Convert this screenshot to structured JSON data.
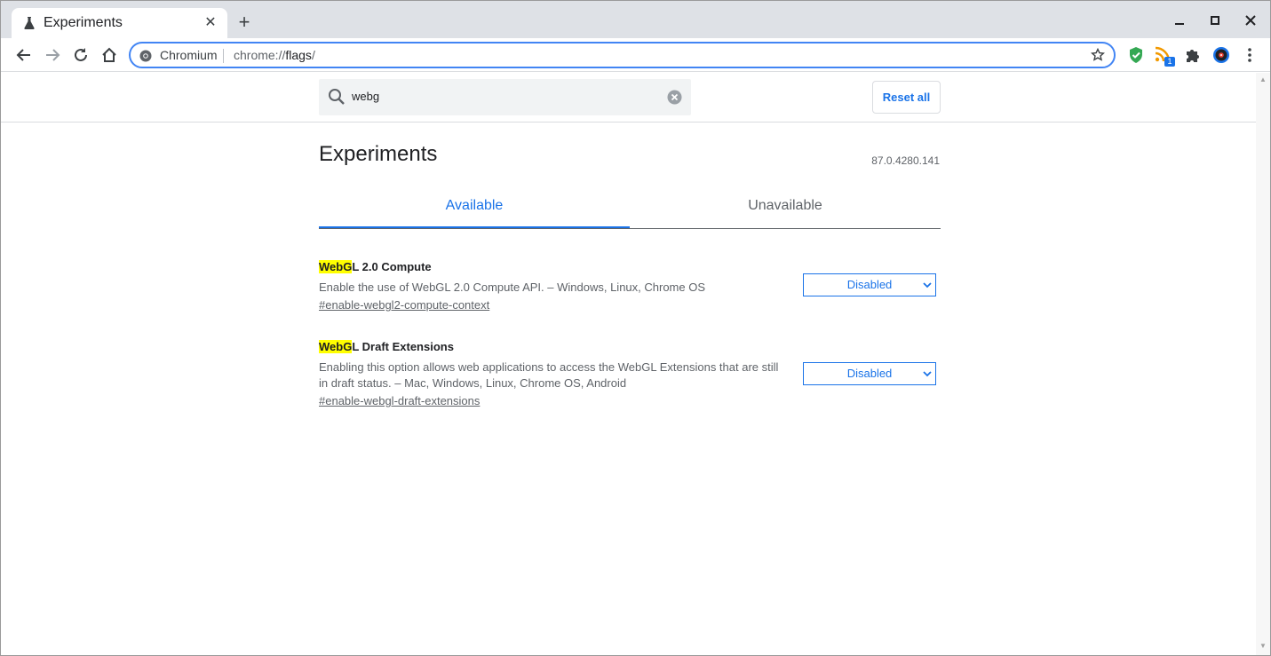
{
  "browser": {
    "tab_title": "Experiments",
    "new_tab_label": "+",
    "omnibox": {
      "site_label": "Chromium",
      "url_scheme": "chrome://",
      "url_host": "flags",
      "url_path": "/"
    },
    "extension_badge": "1"
  },
  "header": {
    "search_value": "webg",
    "reset_label": "Reset all"
  },
  "main": {
    "title": "Experiments",
    "version": "87.0.4280.141",
    "tabs": [
      {
        "label": "Available",
        "active": true
      },
      {
        "label": "Unavailable",
        "active": false
      }
    ],
    "experiments": [
      {
        "name_highlight": "WebG",
        "name_rest": "L 2.0 Compute",
        "description": "Enable the use of WebGL 2.0 Compute API. – Windows, Linux, Chrome OS",
        "link": "#enable-webgl2-compute-context",
        "selected": "Disabled"
      },
      {
        "name_highlight": "WebG",
        "name_rest": "L Draft Extensions",
        "description": "Enabling this option allows web applications to access the WebGL Extensions that are still in draft status. – Mac, Windows, Linux, Chrome OS, Android",
        "link": "#enable-webgl-draft-extensions",
        "selected": "Disabled"
      }
    ]
  },
  "colors": {
    "accent": "#1a73e8",
    "highlight": "#ffff00",
    "tabstrip": "#dee1e6"
  }
}
